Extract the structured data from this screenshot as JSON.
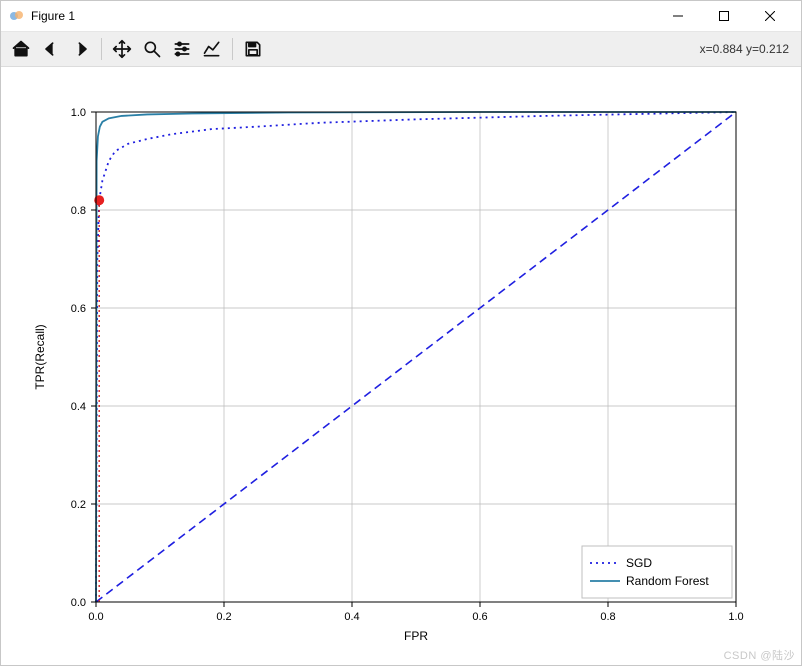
{
  "window": {
    "title": "Figure 1",
    "controls": {
      "minimize": "minimize",
      "maximize": "maximize",
      "close": "close"
    }
  },
  "toolbar": {
    "home": {
      "name": "home-icon"
    },
    "back": {
      "name": "back-icon"
    },
    "forward": {
      "name": "forward-icon"
    },
    "pan": {
      "name": "pan-icon"
    },
    "zoom": {
      "name": "zoom-icon"
    },
    "config": {
      "name": "sliders-icon"
    },
    "edit": {
      "name": "edit-axes-icon"
    },
    "save": {
      "name": "save-icon"
    },
    "coord_readout": "x=0.884 y=0.212"
  },
  "watermark": "CSDN @陆沙",
  "chart_data": {
    "type": "line",
    "title": "",
    "xlabel": "FPR",
    "ylabel": "TPR(Recall)",
    "xlim": [
      0.0,
      1.0
    ],
    "ylim": [
      0.0,
      1.0
    ],
    "xticks": [
      0.0,
      0.2,
      0.4,
      0.6,
      0.8,
      1.0
    ],
    "yticks": [
      0.0,
      0.2,
      0.4,
      0.6,
      0.8,
      1.0
    ],
    "xtick_labels": [
      "0.0",
      "0.2",
      "0.4",
      "0.6",
      "0.8",
      "1.0"
    ],
    "ytick_labels": [
      "0.0",
      "0.2",
      "0.4",
      "0.6",
      "0.8",
      "1.0"
    ],
    "grid": true,
    "legend": {
      "position": "lower right",
      "entries": [
        "SGD",
        "Random Forest"
      ]
    },
    "reference_line": {
      "style": "dashed",
      "color": "#1f1fe0",
      "points": [
        [
          0.0,
          0.0
        ],
        [
          1.0,
          1.0
        ]
      ]
    },
    "marker": {
      "label": "operating-point",
      "color": "#e62020",
      "x": 0.005,
      "y": 0.82
    },
    "marker_guide": {
      "style": "dotted",
      "color": "#d62728",
      "points": [
        [
          0.005,
          0.0
        ],
        [
          0.005,
          0.82
        ]
      ]
    },
    "series": [
      {
        "name": "SGD",
        "style": "dotted",
        "color": "#1f1fe0",
        "x": [
          0.0,
          0.002,
          0.005,
          0.01,
          0.02,
          0.03,
          0.05,
          0.08,
          0.12,
          0.18,
          0.25,
          0.35,
          0.5,
          0.7,
          0.85,
          1.0
        ],
        "y": [
          0.0,
          0.7,
          0.82,
          0.86,
          0.9,
          0.92,
          0.935,
          0.945,
          0.955,
          0.965,
          0.97,
          0.978,
          0.985,
          0.992,
          0.996,
          1.0
        ]
      },
      {
        "name": "Random Forest",
        "style": "solid",
        "color": "#2a7fa6",
        "x": [
          0.0,
          0.001,
          0.003,
          0.006,
          0.01,
          0.02,
          0.04,
          0.08,
          0.15,
          0.3,
          0.6,
          1.0
        ],
        "y": [
          0.0,
          0.9,
          0.95,
          0.97,
          0.98,
          0.987,
          0.992,
          0.995,
          0.997,
          0.999,
          1.0,
          1.0
        ]
      }
    ]
  }
}
